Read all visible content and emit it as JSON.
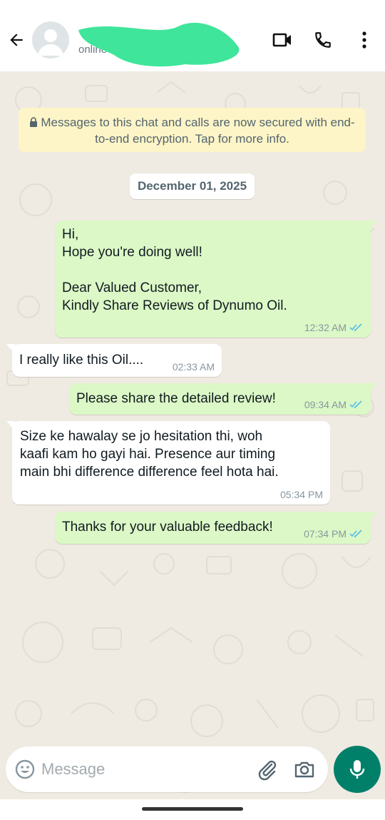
{
  "header": {
    "status": "online"
  },
  "encryption_notice": "Messages to this chat and calls are now secured with end-to-end encryption. Tap for more info.",
  "date_chip": "December 01, 2025",
  "messages": [
    {
      "direction": "outgoing",
      "text": "Hi,\nHope you're doing well!\n\nDear Valued Customer,\nKindly Share Reviews of Dynumo Oil.",
      "time": "12:32 AM",
      "read": true
    },
    {
      "direction": "incoming",
      "text": "I really like this Oil....",
      "time": "02:33 AM"
    },
    {
      "direction": "outgoing",
      "text": "Please share the detailed review!",
      "time": "09:34 AM",
      "read": true
    },
    {
      "direction": "incoming",
      "text": "Size ke hawalay se jo hesitation thi, woh\nkaafi kam ho gayi hai. Presence aur timing\nmain bhi difference difference feel hota hai.",
      "time": "05:34 PM"
    },
    {
      "direction": "outgoing",
      "text": "Thanks for your valuable feedback!",
      "time": "07:34 PM",
      "read": true
    }
  ],
  "composer": {
    "placeholder": "Message"
  },
  "colors": {
    "accent": "#008069",
    "outgoing_bubble": "#dcf8c6",
    "incoming_bubble": "#ffffff",
    "chat_background": "#efeae2",
    "read_ticks": "#53bdeb",
    "redaction_marker": "#3fe59a"
  },
  "icons": [
    "back-arrow-icon",
    "avatar-icon",
    "video-call-icon",
    "phone-icon",
    "more-options-icon",
    "lock-icon",
    "double-tick-icon",
    "emoji-icon",
    "attach-icon",
    "camera-icon",
    "mic-icon"
  ]
}
